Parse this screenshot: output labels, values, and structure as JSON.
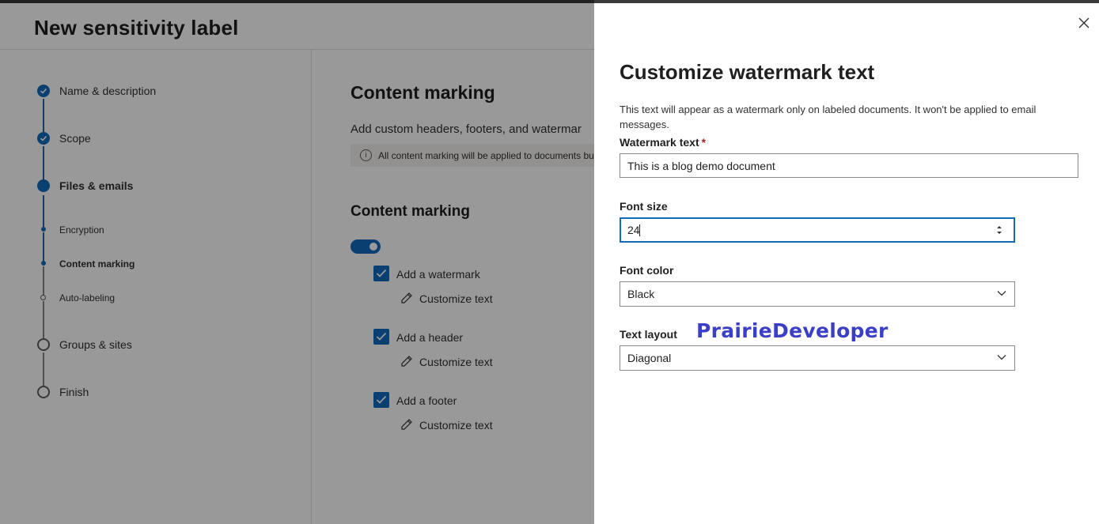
{
  "page": {
    "title": "New sensitivity label"
  },
  "wizard": {
    "steps": [
      {
        "label": "Name & description",
        "state": "done"
      },
      {
        "label": "Scope",
        "state": "done"
      },
      {
        "label": "Files & emails",
        "state": "current"
      },
      {
        "label": "Encryption",
        "state": "sub-done"
      },
      {
        "label": "Content marking",
        "state": "sub-current"
      },
      {
        "label": "Auto-labeling",
        "state": "sub-pending"
      },
      {
        "label": "Groups & sites",
        "state": "pending"
      },
      {
        "label": "Finish",
        "state": "pending"
      }
    ]
  },
  "content": {
    "title": "Content marking",
    "description": "Add custom headers, footers, and watermar",
    "info": "All content marking will be applied to documents bu",
    "section_title": "Content marking",
    "toggle_on": true,
    "options": [
      {
        "label": "Add a watermark",
        "checked": true,
        "action": "Customize text"
      },
      {
        "label": "Add a header",
        "checked": true,
        "action": "Customize text"
      },
      {
        "label": "Add a footer",
        "checked": true,
        "action": "Customize text"
      }
    ]
  },
  "panel": {
    "title": "Customize watermark text",
    "description": "This text will appear as a watermark only on labeled documents. It won't be applied to email messages.",
    "watermark_label": "Watermark text",
    "required_mark": "*",
    "watermark_value": "This is a blog demo document",
    "font_size_label": "Font size",
    "font_size_value": "24",
    "font_color_label": "Font color",
    "font_color_value": "Black",
    "text_layout_label": "Text layout",
    "text_layout_value": "Diagonal"
  },
  "watermark_brand": "PrairieDeveloper",
  "colors": {
    "accent": "#0f6cbd",
    "brand_text": "#3a3fc6",
    "overlay": "rgba(0,0,0,0.40)"
  },
  "icons": {
    "close": "close-icon",
    "check": "checkmark-icon",
    "pencil": "pencil-icon",
    "info": "info-icon",
    "chevron": "chevron-down-icon",
    "spinner": "spin-arrows-icon"
  }
}
